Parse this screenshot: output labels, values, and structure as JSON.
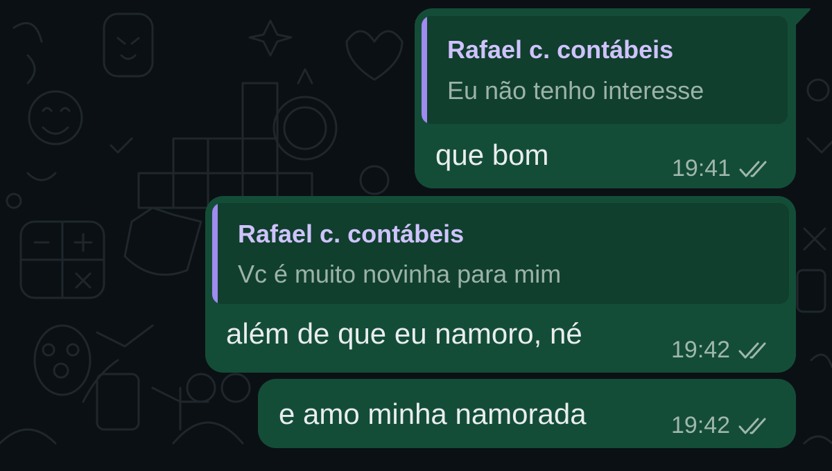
{
  "chat": {
    "messages": [
      {
        "quote": {
          "author": "Rafael c. contábeis",
          "text": "Eu não tenho interesse"
        },
        "text": "que bom",
        "time": "19:41",
        "status_icon": "double-check-icon"
      },
      {
        "quote": {
          "author": "Rafael c. contábeis",
          "text": "Vc é muito novinha para mim"
        },
        "text": "além de que eu namoro, né",
        "time": "19:42",
        "status_icon": "double-check-icon"
      },
      {
        "text": "e amo minha namorada",
        "time": "19:42",
        "status_icon": "double-check-icon"
      }
    ]
  },
  "colors": {
    "background": "#0b1014",
    "outgoing_bubble": "#144d37",
    "quote_background": "#103f2d",
    "quote_bar": "#a08bf0",
    "quote_author": "#cfc3ff",
    "message_text": "#e9edef",
    "meta_text": "#9fb7ac"
  }
}
